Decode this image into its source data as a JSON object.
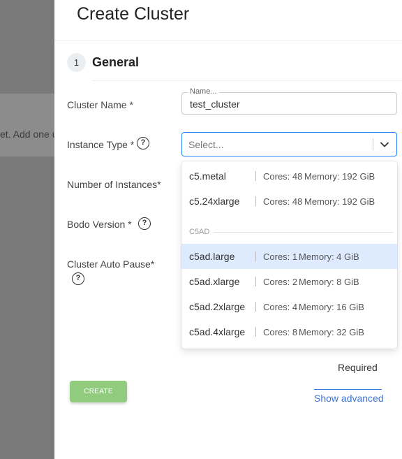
{
  "background": {
    "partial_text": "et. Add one u"
  },
  "dialog": {
    "title": "Create Cluster",
    "step": {
      "number": "1",
      "label": "General"
    }
  },
  "form": {
    "cluster_name": {
      "label": "Cluster Name *",
      "legend": "Name...",
      "value": "test_cluster"
    },
    "instance_type": {
      "label": "Instance Type *",
      "placeholder": "Select..."
    },
    "number_of_instances": {
      "label": "Number of Instances*"
    },
    "bodo_version": {
      "label": "Bodo Version *"
    },
    "auto_pause": {
      "label": "Cluster Auto Pause*"
    },
    "help_glyph": "?"
  },
  "dropdown": {
    "options_top": [
      {
        "name": "c5.metal",
        "cores": "Cores: 48",
        "memory": "Memory: 192 GiB"
      },
      {
        "name": "c5.24xlarge",
        "cores": "Cores: 48",
        "memory": "Memory: 192 GiB"
      }
    ],
    "group": "C5AD",
    "options_group": [
      {
        "name": "c5ad.large",
        "cores": "Cores: 1",
        "memory": "Memory: 4 GiB",
        "highlighted": true
      },
      {
        "name": "c5ad.xlarge",
        "cores": "Cores: 2",
        "memory": "Memory: 8 GiB"
      },
      {
        "name": "c5ad.2xlarge",
        "cores": "Cores: 4",
        "memory": "Memory: 16 GiB"
      },
      {
        "name": "c5ad.4xlarge",
        "cores": "Cores: 8",
        "memory": "Memory: 32 GiB"
      }
    ]
  },
  "footer": {
    "required_text": "Required",
    "create_label": "CREATE",
    "show_advanced_label": "Show advanced"
  },
  "colors": {
    "accent": "#2684ff",
    "highlight": "#deebff",
    "create_button": "#90cb7e",
    "link": "#3b74d8",
    "overlay": "#7a7a7a"
  }
}
